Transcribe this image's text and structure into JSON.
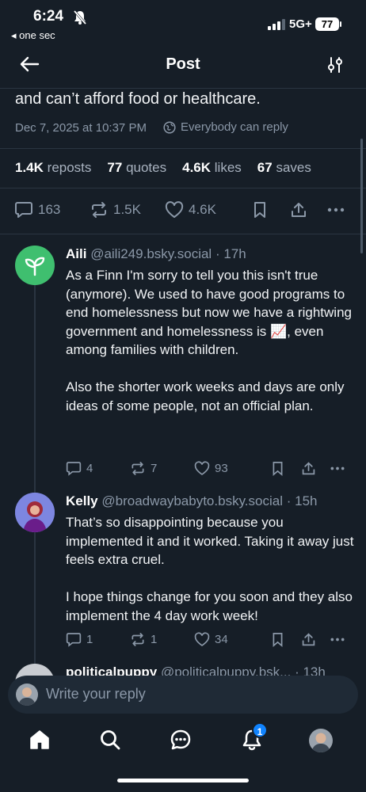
{
  "status_bar": {
    "time": "6:24",
    "back_app": "◂ one sec",
    "network": "5G+",
    "battery": "77"
  },
  "header": {
    "title": "Post"
  },
  "post": {
    "text_tail": "and can’t afford food or healthcare.",
    "date": "Dec 7, 2025 at 10:37 PM",
    "reply_setting": "Everybody can reply",
    "stats": {
      "reposts_count": "1.4K",
      "reposts_label": "reposts",
      "quotes_count": "77",
      "quotes_label": "quotes",
      "likes_count": "4.6K",
      "likes_label": "likes",
      "saves_count": "67",
      "saves_label": "saves"
    },
    "actions": {
      "replies": "163",
      "reposts": "1.5K",
      "likes": "4.6K"
    }
  },
  "replies": [
    {
      "name": "Aili",
      "handle": "@aili249.bsky.social",
      "time": "· 17h",
      "body_1": "As a Finn I'm sorry to tell you this isn't true (anymore). We used to have good programs to end homelessness but now we have a rightwing government and homelessness is 📈, even among families with children.",
      "body_2": "Also the shorter work weeks and days are only ideas of some people, not an official plan.",
      "replies": "4",
      "reposts": "7",
      "likes": "93",
      "avatar_color": "#3fbf6f"
    },
    {
      "name": "Kelly",
      "handle": "@broadwaybabyto.bsky.social",
      "time": "· 15h",
      "body_1": "That’s so disappointing because you implemented it and it worked. Taking it away just feels extra cruel.",
      "body_2": "I hope things change for you soon and they also implement the 4 day work week!",
      "replies": "1",
      "reposts": "1",
      "likes": "34"
    },
    {
      "name": "politicalpuppy",
      "handle": "@politicalpuppy.bsk...",
      "time": "· 13h"
    }
  ],
  "compose": {
    "placeholder": "Write your reply"
  },
  "tabbar": {
    "notifications_badge": "1"
  },
  "colors": {
    "background": "#161e27",
    "muted": "#8b98a8",
    "accent": "#1083fe",
    "divider": "#2a3541"
  }
}
